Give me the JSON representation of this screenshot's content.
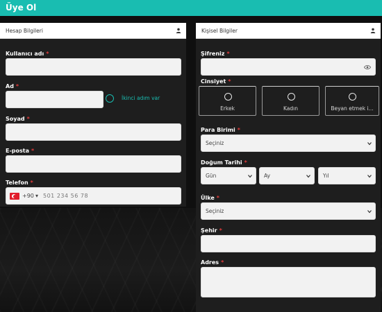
{
  "header": {
    "title": "Üye Ol"
  },
  "account_panel": {
    "title": "Hesap Bilgileri",
    "username_label": "Kullanıcı adı",
    "name_label": "Ad",
    "second_name_label": "İkinci adım var",
    "surname_label": "Soyad",
    "email_label": "E-posta",
    "phone_label": "Telefon",
    "phone_code": "+90",
    "phone_placeholder": "501 234 56 78"
  },
  "personal_panel": {
    "title": "Kişisel Bilgiler",
    "password_label": "Şifreniz",
    "gender_label": "Cinsiyet",
    "gender_options": [
      "Erkek",
      "Kadın",
      "Beyan etmek i..."
    ],
    "currency_label": "Para Birimi",
    "currency_value": "Seçiniz",
    "birth_label": "Doğum Tarihi",
    "birth_day": "Gün",
    "birth_month": "Ay",
    "birth_year": "Yıl",
    "country_label": "Ülke",
    "country_value": "Seçiniz",
    "city_label": "Şehir",
    "address_label": "Adres",
    "required_mark": "*"
  },
  "colors": {
    "accent": "#19bdb1",
    "required": "#e03a3a",
    "panel": "#1e1e1e"
  }
}
